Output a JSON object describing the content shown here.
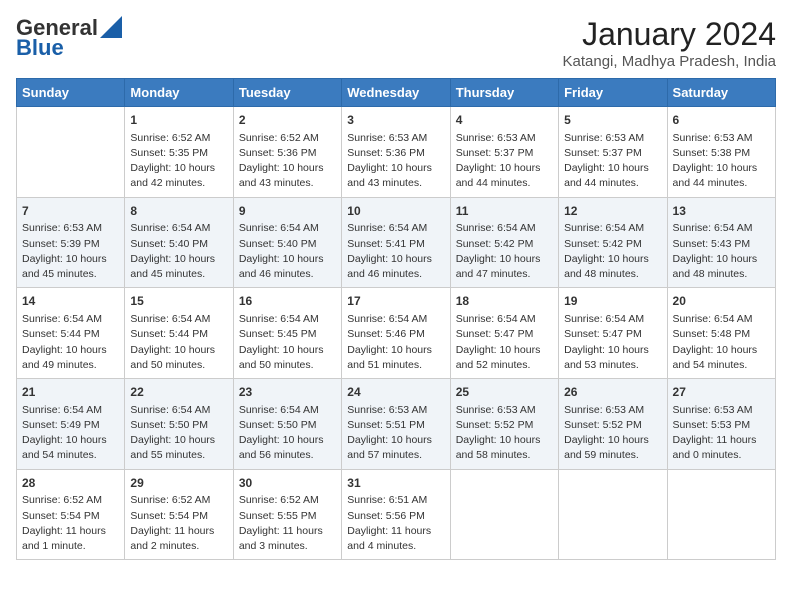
{
  "header": {
    "logo_line1": "General",
    "logo_line2": "Blue",
    "title": "January 2024",
    "subtitle": "Katangi, Madhya Pradesh, India"
  },
  "days_of_week": [
    "Sunday",
    "Monday",
    "Tuesday",
    "Wednesday",
    "Thursday",
    "Friday",
    "Saturday"
  ],
  "weeks": [
    [
      {
        "day": "",
        "content": ""
      },
      {
        "day": "1",
        "content": "Sunrise: 6:52 AM\nSunset: 5:35 PM\nDaylight: 10 hours\nand 42 minutes."
      },
      {
        "day": "2",
        "content": "Sunrise: 6:52 AM\nSunset: 5:36 PM\nDaylight: 10 hours\nand 43 minutes."
      },
      {
        "day": "3",
        "content": "Sunrise: 6:53 AM\nSunset: 5:36 PM\nDaylight: 10 hours\nand 43 minutes."
      },
      {
        "day": "4",
        "content": "Sunrise: 6:53 AM\nSunset: 5:37 PM\nDaylight: 10 hours\nand 44 minutes."
      },
      {
        "day": "5",
        "content": "Sunrise: 6:53 AM\nSunset: 5:37 PM\nDaylight: 10 hours\nand 44 minutes."
      },
      {
        "day": "6",
        "content": "Sunrise: 6:53 AM\nSunset: 5:38 PM\nDaylight: 10 hours\nand 44 minutes."
      }
    ],
    [
      {
        "day": "7",
        "content": "Sunrise: 6:53 AM\nSunset: 5:39 PM\nDaylight: 10 hours\nand 45 minutes."
      },
      {
        "day": "8",
        "content": "Sunrise: 6:54 AM\nSunset: 5:40 PM\nDaylight: 10 hours\nand 45 minutes."
      },
      {
        "day": "9",
        "content": "Sunrise: 6:54 AM\nSunset: 5:40 PM\nDaylight: 10 hours\nand 46 minutes."
      },
      {
        "day": "10",
        "content": "Sunrise: 6:54 AM\nSunset: 5:41 PM\nDaylight: 10 hours\nand 46 minutes."
      },
      {
        "day": "11",
        "content": "Sunrise: 6:54 AM\nSunset: 5:42 PM\nDaylight: 10 hours\nand 47 minutes."
      },
      {
        "day": "12",
        "content": "Sunrise: 6:54 AM\nSunset: 5:42 PM\nDaylight: 10 hours\nand 48 minutes."
      },
      {
        "day": "13",
        "content": "Sunrise: 6:54 AM\nSunset: 5:43 PM\nDaylight: 10 hours\nand 48 minutes."
      }
    ],
    [
      {
        "day": "14",
        "content": "Sunrise: 6:54 AM\nSunset: 5:44 PM\nDaylight: 10 hours\nand 49 minutes."
      },
      {
        "day": "15",
        "content": "Sunrise: 6:54 AM\nSunset: 5:44 PM\nDaylight: 10 hours\nand 50 minutes."
      },
      {
        "day": "16",
        "content": "Sunrise: 6:54 AM\nSunset: 5:45 PM\nDaylight: 10 hours\nand 50 minutes."
      },
      {
        "day": "17",
        "content": "Sunrise: 6:54 AM\nSunset: 5:46 PM\nDaylight: 10 hours\nand 51 minutes."
      },
      {
        "day": "18",
        "content": "Sunrise: 6:54 AM\nSunset: 5:47 PM\nDaylight: 10 hours\nand 52 minutes."
      },
      {
        "day": "19",
        "content": "Sunrise: 6:54 AM\nSunset: 5:47 PM\nDaylight: 10 hours\nand 53 minutes."
      },
      {
        "day": "20",
        "content": "Sunrise: 6:54 AM\nSunset: 5:48 PM\nDaylight: 10 hours\nand 54 minutes."
      }
    ],
    [
      {
        "day": "21",
        "content": "Sunrise: 6:54 AM\nSunset: 5:49 PM\nDaylight: 10 hours\nand 54 minutes."
      },
      {
        "day": "22",
        "content": "Sunrise: 6:54 AM\nSunset: 5:50 PM\nDaylight: 10 hours\nand 55 minutes."
      },
      {
        "day": "23",
        "content": "Sunrise: 6:54 AM\nSunset: 5:50 PM\nDaylight: 10 hours\nand 56 minutes."
      },
      {
        "day": "24",
        "content": "Sunrise: 6:53 AM\nSunset: 5:51 PM\nDaylight: 10 hours\nand 57 minutes."
      },
      {
        "day": "25",
        "content": "Sunrise: 6:53 AM\nSunset: 5:52 PM\nDaylight: 10 hours\nand 58 minutes."
      },
      {
        "day": "26",
        "content": "Sunrise: 6:53 AM\nSunset: 5:52 PM\nDaylight: 10 hours\nand 59 minutes."
      },
      {
        "day": "27",
        "content": "Sunrise: 6:53 AM\nSunset: 5:53 PM\nDaylight: 11 hours\nand 0 minutes."
      }
    ],
    [
      {
        "day": "28",
        "content": "Sunrise: 6:52 AM\nSunset: 5:54 PM\nDaylight: 11 hours\nand 1 minute."
      },
      {
        "day": "29",
        "content": "Sunrise: 6:52 AM\nSunset: 5:54 PM\nDaylight: 11 hours\nand 2 minutes."
      },
      {
        "day": "30",
        "content": "Sunrise: 6:52 AM\nSunset: 5:55 PM\nDaylight: 11 hours\nand 3 minutes."
      },
      {
        "day": "31",
        "content": "Sunrise: 6:51 AM\nSunset: 5:56 PM\nDaylight: 11 hours\nand 4 minutes."
      },
      {
        "day": "",
        "content": ""
      },
      {
        "day": "",
        "content": ""
      },
      {
        "day": "",
        "content": ""
      }
    ]
  ]
}
